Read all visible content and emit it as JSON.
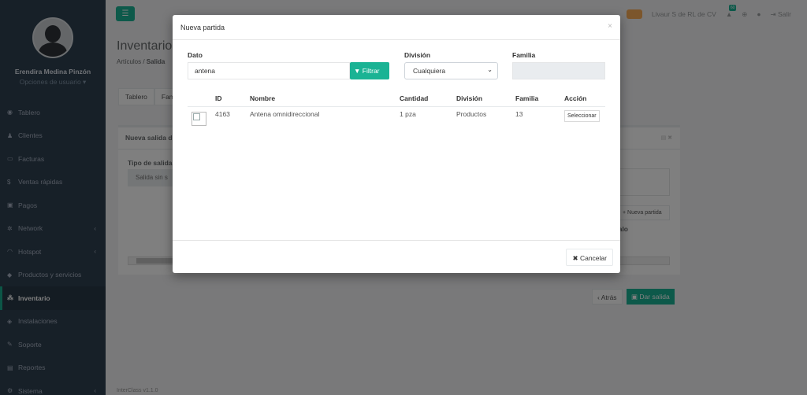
{
  "sidebar": {
    "profile_name": "Erendira Medina Pinzón",
    "profile_options": "Opciones de usuario ▾",
    "items": [
      {
        "label": "Tablero",
        "icon": "dashboard-icon",
        "glyph": "◉"
      },
      {
        "label": "Clientes",
        "icon": "users-icon",
        "glyph": "👥"
      },
      {
        "label": "Facturas",
        "icon": "file-icon",
        "glyph": "▭"
      },
      {
        "label": "Ventas rápidas",
        "icon": "dollar-icon",
        "glyph": "$"
      },
      {
        "label": "Pagos",
        "icon": "money-icon",
        "glyph": "▣"
      },
      {
        "label": "Network",
        "icon": "network-icon",
        "glyph": "✲"
      },
      {
        "label": "Hotspot",
        "icon": "wifi-icon",
        "glyph": "◠"
      },
      {
        "label": "Productos y servicios",
        "icon": "tag-icon",
        "glyph": "◆"
      },
      {
        "label": "Inventario",
        "icon": "cubes-icon",
        "glyph": "⁂"
      },
      {
        "label": "Instalaciones",
        "icon": "tools-icon",
        "glyph": "◈"
      },
      {
        "label": "Soporte",
        "icon": "wrench-icon",
        "glyph": "🔧"
      },
      {
        "label": "Reportes",
        "icon": "report-icon",
        "glyph": "▤"
      },
      {
        "label": "Sistema",
        "icon": "cogs-icon",
        "glyph": "⚙"
      }
    ]
  },
  "topbar": {
    "menu_icon": "☰",
    "company": "Livaur S de RL de CV",
    "notif_count": "60",
    "logout": "Salir"
  },
  "page": {
    "title": "Inventario",
    "breadcrumb_root": "Artículos",
    "breadcrumb_current": "Salida",
    "tabs": [
      "Tablero",
      "Fam"
    ],
    "box_title": "Nueva salida d",
    "type_label": "Tipo de salida",
    "type_value": "Salida sin s",
    "new_item_btn": "+ Nueva partida",
    "total_label": "alo",
    "back_btn": "‹ Atrás",
    "save_btn": "Dar salida",
    "footer": "InterClass v1.1.0"
  },
  "modal": {
    "title": "Nueva partida",
    "close": "×",
    "dato_label": "Dato",
    "dato_value": "antena",
    "filter_btn": "Filtrar",
    "division_label": "División",
    "division_value": "Cualquiera",
    "familia_label": "Familia",
    "columns": [
      "ID",
      "Nombre",
      "Cantidad",
      "División",
      "Familia",
      "Acción"
    ],
    "rows": [
      {
        "id": "4163",
        "nombre": "Antena omnidireccional",
        "cantidad": "1 pza",
        "division": "Productos",
        "familia": "13",
        "accion": "Seleccionar"
      }
    ],
    "cancel_btn": "Cancelar"
  },
  "colors": {
    "accent": "#1ab394",
    "sidebar": "#2f4050",
    "warning": "#f8ac59"
  }
}
